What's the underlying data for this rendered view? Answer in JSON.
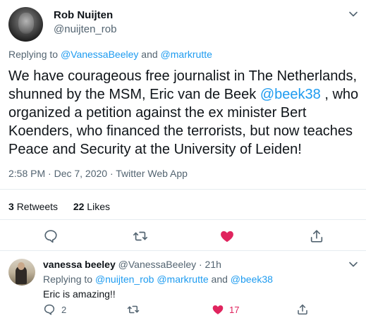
{
  "tweet": {
    "author": {
      "name": "Rob Nuijten",
      "handle": "@nuijten_rob"
    },
    "replying": {
      "prefix": "Replying to",
      "user1": "@VanessaBeeley",
      "and": "and",
      "user2": "@markrutte"
    },
    "text_part1": "We have courageous free journalist in The Netherlands, shunned by the MSM, Eric van de Beek",
    "mention": "@beek38",
    "text_part2": ", who organized a petition against the ex minister Bert Koenders, who financed the terrorists, but now teaches Peace and Security at the University of Leiden!",
    "timestamp": "2:58 PM · Dec 7, 2020 · Twitter Web App",
    "stats": {
      "retweets_count": "3",
      "retweets_label": "Retweets",
      "likes_count": "22",
      "likes_label": "Likes"
    }
  },
  "reply": {
    "name": "vanessa beeley",
    "handle_time": "@VanessaBeeley · 21h",
    "replying_prefix": "Replying to",
    "replying_users": "@nuijten_rob @markrutte",
    "replying_and": "and",
    "replying_user3": "@beek38",
    "text": "Eric is amazing!!",
    "actions": {
      "reply_count": "2",
      "like_count": "17"
    }
  },
  "colors": {
    "link": "#1d9bf0",
    "like_active": "#e0245e",
    "secondary_text": "#536471",
    "divider": "#e6ecf0"
  },
  "icons": [
    "chevron-down-icon",
    "reply-icon",
    "retweet-icon",
    "heart-icon",
    "share-icon"
  ]
}
